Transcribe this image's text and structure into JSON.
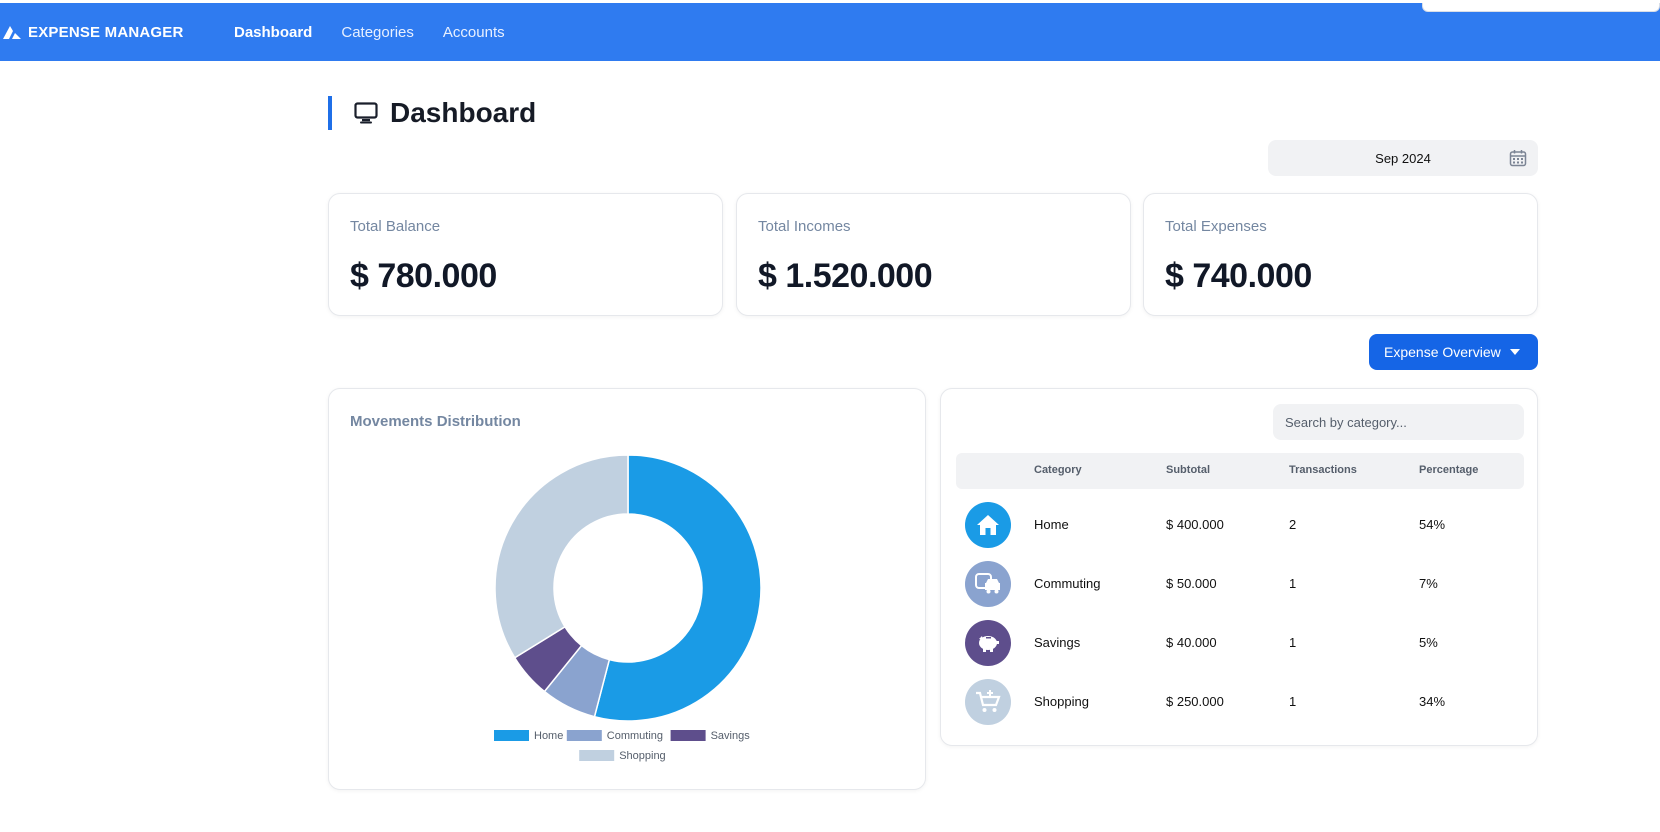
{
  "app": {
    "brand": "EXPENSE MANAGER"
  },
  "nav": [
    {
      "label": "Dashboard",
      "active": true
    },
    {
      "label": "Categories",
      "active": false
    },
    {
      "label": "Accounts",
      "active": false
    }
  ],
  "page": {
    "title": "Dashboard"
  },
  "date_picker": {
    "value": "Sep 2024"
  },
  "stats": [
    {
      "label": "Total Balance",
      "value": "$ 780.000"
    },
    {
      "label": "Total Incomes",
      "value": "$ 1.520.000"
    },
    {
      "label": "Total Expenses",
      "value": "$ 740.000"
    }
  ],
  "overview_button": {
    "label": "Expense Overview"
  },
  "chart_card": {
    "title": "Movements Distribution"
  },
  "chart_data": {
    "type": "pie",
    "variant": "doughnut",
    "categories": [
      "Home",
      "Commuting",
      "Savings",
      "Shopping"
    ],
    "values": [
      400000,
      50000,
      40000,
      250000
    ],
    "colors": [
      "#1a9be6",
      "#8aa3cf",
      "#5e4e8c",
      "#c0d0e0"
    ],
    "legend_position": "bottom",
    "title": ""
  },
  "table": {
    "search_placeholder": "Search by category...",
    "headers": {
      "category": "Category",
      "subtotal": "Subtotal",
      "transactions": "Transactions",
      "percentage": "Percentage"
    },
    "rows": [
      {
        "category": "Home",
        "subtotal": "$ 400.000",
        "transactions": "2",
        "percentage": "54%",
        "icon": "home-icon",
        "color": "#1a9be6"
      },
      {
        "category": "Commuting",
        "subtotal": "$ 50.000",
        "transactions": "1",
        "percentage": "7%",
        "icon": "car-icon",
        "color": "#8aa3cf"
      },
      {
        "category": "Savings",
        "subtotal": "$ 40.000",
        "transactions": "1",
        "percentage": "5%",
        "icon": "piggy-bank-icon",
        "color": "#5e4e8c"
      },
      {
        "category": "Shopping",
        "subtotal": "$ 250.000",
        "transactions": "1",
        "percentage": "34%",
        "icon": "cart-icon",
        "color": "#c0d0e0"
      }
    ]
  }
}
